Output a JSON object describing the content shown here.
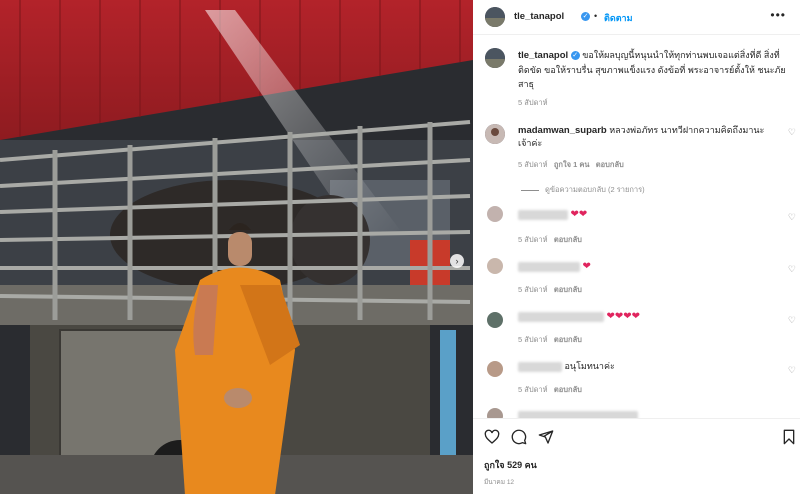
{
  "post": {
    "username": "tle_tanapol",
    "follow_label": "ติดตาม",
    "more_label": "•••",
    "caption": "ขอให้ผลบุญนี้หนุนนำให้ทุกท่านพบเจอแต่สิ่งที่ดี สิ่งที่ติดขัด ขอให้ราบรื่น สุขภาพแข็งแรง ดังข้อที่ พระอาจารย์ตั้งให้ ชนะภัย สาธุ",
    "caption_time": "5 สัปดาห์",
    "next_arrow": "›"
  },
  "comments": [
    {
      "username": "madamwan_suparb",
      "text": "หลวงพ่อภัทร นาทวีฝากความคิดถึงมานะเจ้าค่ะ",
      "time": "5 สัปดาห์",
      "likes": "ถูกใจ 1 คน",
      "reply": "ตอบกลับ",
      "view_replies": "ดูข้อความตอบกลับ (2 รายการ)"
    },
    {
      "username": "",
      "text": "",
      "emoji": "❤❤",
      "time": "5 สัปดาห์",
      "reply": "ตอบกลับ"
    },
    {
      "username": "",
      "text": "",
      "emoji": "❤",
      "time": "5 สัปดาห์",
      "reply": "ตอบกลับ"
    },
    {
      "username": "",
      "text": "",
      "emoji": "❤❤❤❤",
      "time": "5 สัปดาห์",
      "reply": "ตอบกลับ"
    },
    {
      "username": "",
      "text": "อนุโมทนาค่ะ",
      "time": "5 สัปดาห์",
      "reply": "ตอบกลับ"
    }
  ],
  "footer": {
    "likes": "ถูกใจ 529 คน",
    "date": "มีนาคม 12"
  },
  "icons": {
    "heart": "heart-icon",
    "comment": "comment-icon",
    "share": "share-icon",
    "bookmark": "bookmark-icon",
    "verified": "verified-badge-icon"
  },
  "colors": {
    "follow": "#0095f6",
    "verified": "#3897f0",
    "heart": "#e0245e",
    "robe": "#e8891e"
  }
}
